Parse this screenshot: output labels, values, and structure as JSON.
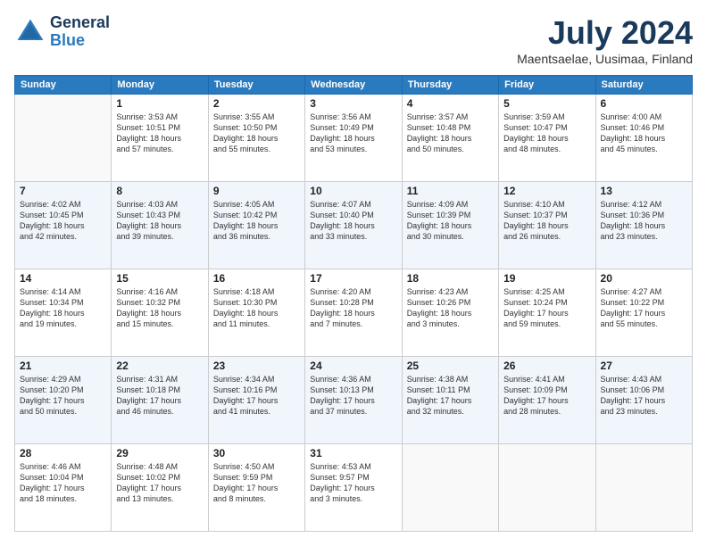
{
  "header": {
    "logo_line1": "General",
    "logo_line2": "Blue",
    "month": "July 2024",
    "location": "Maentsaelae, Uusimaa, Finland"
  },
  "days_of_week": [
    "Sunday",
    "Monday",
    "Tuesday",
    "Wednesday",
    "Thursday",
    "Friday",
    "Saturday"
  ],
  "weeks": [
    [
      {
        "day": "",
        "text": ""
      },
      {
        "day": "1",
        "text": "Sunrise: 3:53 AM\nSunset: 10:51 PM\nDaylight: 18 hours\nand 57 minutes."
      },
      {
        "day": "2",
        "text": "Sunrise: 3:55 AM\nSunset: 10:50 PM\nDaylight: 18 hours\nand 55 minutes."
      },
      {
        "day": "3",
        "text": "Sunrise: 3:56 AM\nSunset: 10:49 PM\nDaylight: 18 hours\nand 53 minutes."
      },
      {
        "day": "4",
        "text": "Sunrise: 3:57 AM\nSunset: 10:48 PM\nDaylight: 18 hours\nand 50 minutes."
      },
      {
        "day": "5",
        "text": "Sunrise: 3:59 AM\nSunset: 10:47 PM\nDaylight: 18 hours\nand 48 minutes."
      },
      {
        "day": "6",
        "text": "Sunrise: 4:00 AM\nSunset: 10:46 PM\nDaylight: 18 hours\nand 45 minutes."
      }
    ],
    [
      {
        "day": "7",
        "text": "Sunrise: 4:02 AM\nSunset: 10:45 PM\nDaylight: 18 hours\nand 42 minutes."
      },
      {
        "day": "8",
        "text": "Sunrise: 4:03 AM\nSunset: 10:43 PM\nDaylight: 18 hours\nand 39 minutes."
      },
      {
        "day": "9",
        "text": "Sunrise: 4:05 AM\nSunset: 10:42 PM\nDaylight: 18 hours\nand 36 minutes."
      },
      {
        "day": "10",
        "text": "Sunrise: 4:07 AM\nSunset: 10:40 PM\nDaylight: 18 hours\nand 33 minutes."
      },
      {
        "day": "11",
        "text": "Sunrise: 4:09 AM\nSunset: 10:39 PM\nDaylight: 18 hours\nand 30 minutes."
      },
      {
        "day": "12",
        "text": "Sunrise: 4:10 AM\nSunset: 10:37 PM\nDaylight: 18 hours\nand 26 minutes."
      },
      {
        "day": "13",
        "text": "Sunrise: 4:12 AM\nSunset: 10:36 PM\nDaylight: 18 hours\nand 23 minutes."
      }
    ],
    [
      {
        "day": "14",
        "text": "Sunrise: 4:14 AM\nSunset: 10:34 PM\nDaylight: 18 hours\nand 19 minutes."
      },
      {
        "day": "15",
        "text": "Sunrise: 4:16 AM\nSunset: 10:32 PM\nDaylight: 18 hours\nand 15 minutes."
      },
      {
        "day": "16",
        "text": "Sunrise: 4:18 AM\nSunset: 10:30 PM\nDaylight: 18 hours\nand 11 minutes."
      },
      {
        "day": "17",
        "text": "Sunrise: 4:20 AM\nSunset: 10:28 PM\nDaylight: 18 hours\nand 7 minutes."
      },
      {
        "day": "18",
        "text": "Sunrise: 4:23 AM\nSunset: 10:26 PM\nDaylight: 18 hours\nand 3 minutes."
      },
      {
        "day": "19",
        "text": "Sunrise: 4:25 AM\nSunset: 10:24 PM\nDaylight: 17 hours\nand 59 minutes."
      },
      {
        "day": "20",
        "text": "Sunrise: 4:27 AM\nSunset: 10:22 PM\nDaylight: 17 hours\nand 55 minutes."
      }
    ],
    [
      {
        "day": "21",
        "text": "Sunrise: 4:29 AM\nSunset: 10:20 PM\nDaylight: 17 hours\nand 50 minutes."
      },
      {
        "day": "22",
        "text": "Sunrise: 4:31 AM\nSunset: 10:18 PM\nDaylight: 17 hours\nand 46 minutes."
      },
      {
        "day": "23",
        "text": "Sunrise: 4:34 AM\nSunset: 10:16 PM\nDaylight: 17 hours\nand 41 minutes."
      },
      {
        "day": "24",
        "text": "Sunrise: 4:36 AM\nSunset: 10:13 PM\nDaylight: 17 hours\nand 37 minutes."
      },
      {
        "day": "25",
        "text": "Sunrise: 4:38 AM\nSunset: 10:11 PM\nDaylight: 17 hours\nand 32 minutes."
      },
      {
        "day": "26",
        "text": "Sunrise: 4:41 AM\nSunset: 10:09 PM\nDaylight: 17 hours\nand 28 minutes."
      },
      {
        "day": "27",
        "text": "Sunrise: 4:43 AM\nSunset: 10:06 PM\nDaylight: 17 hours\nand 23 minutes."
      }
    ],
    [
      {
        "day": "28",
        "text": "Sunrise: 4:46 AM\nSunset: 10:04 PM\nDaylight: 17 hours\nand 18 minutes."
      },
      {
        "day": "29",
        "text": "Sunrise: 4:48 AM\nSunset: 10:02 PM\nDaylight: 17 hours\nand 13 minutes."
      },
      {
        "day": "30",
        "text": "Sunrise: 4:50 AM\nSunset: 9:59 PM\nDaylight: 17 hours\nand 8 minutes."
      },
      {
        "day": "31",
        "text": "Sunrise: 4:53 AM\nSunset: 9:57 PM\nDaylight: 17 hours\nand 3 minutes."
      },
      {
        "day": "",
        "text": ""
      },
      {
        "day": "",
        "text": ""
      },
      {
        "day": "",
        "text": ""
      }
    ]
  ]
}
